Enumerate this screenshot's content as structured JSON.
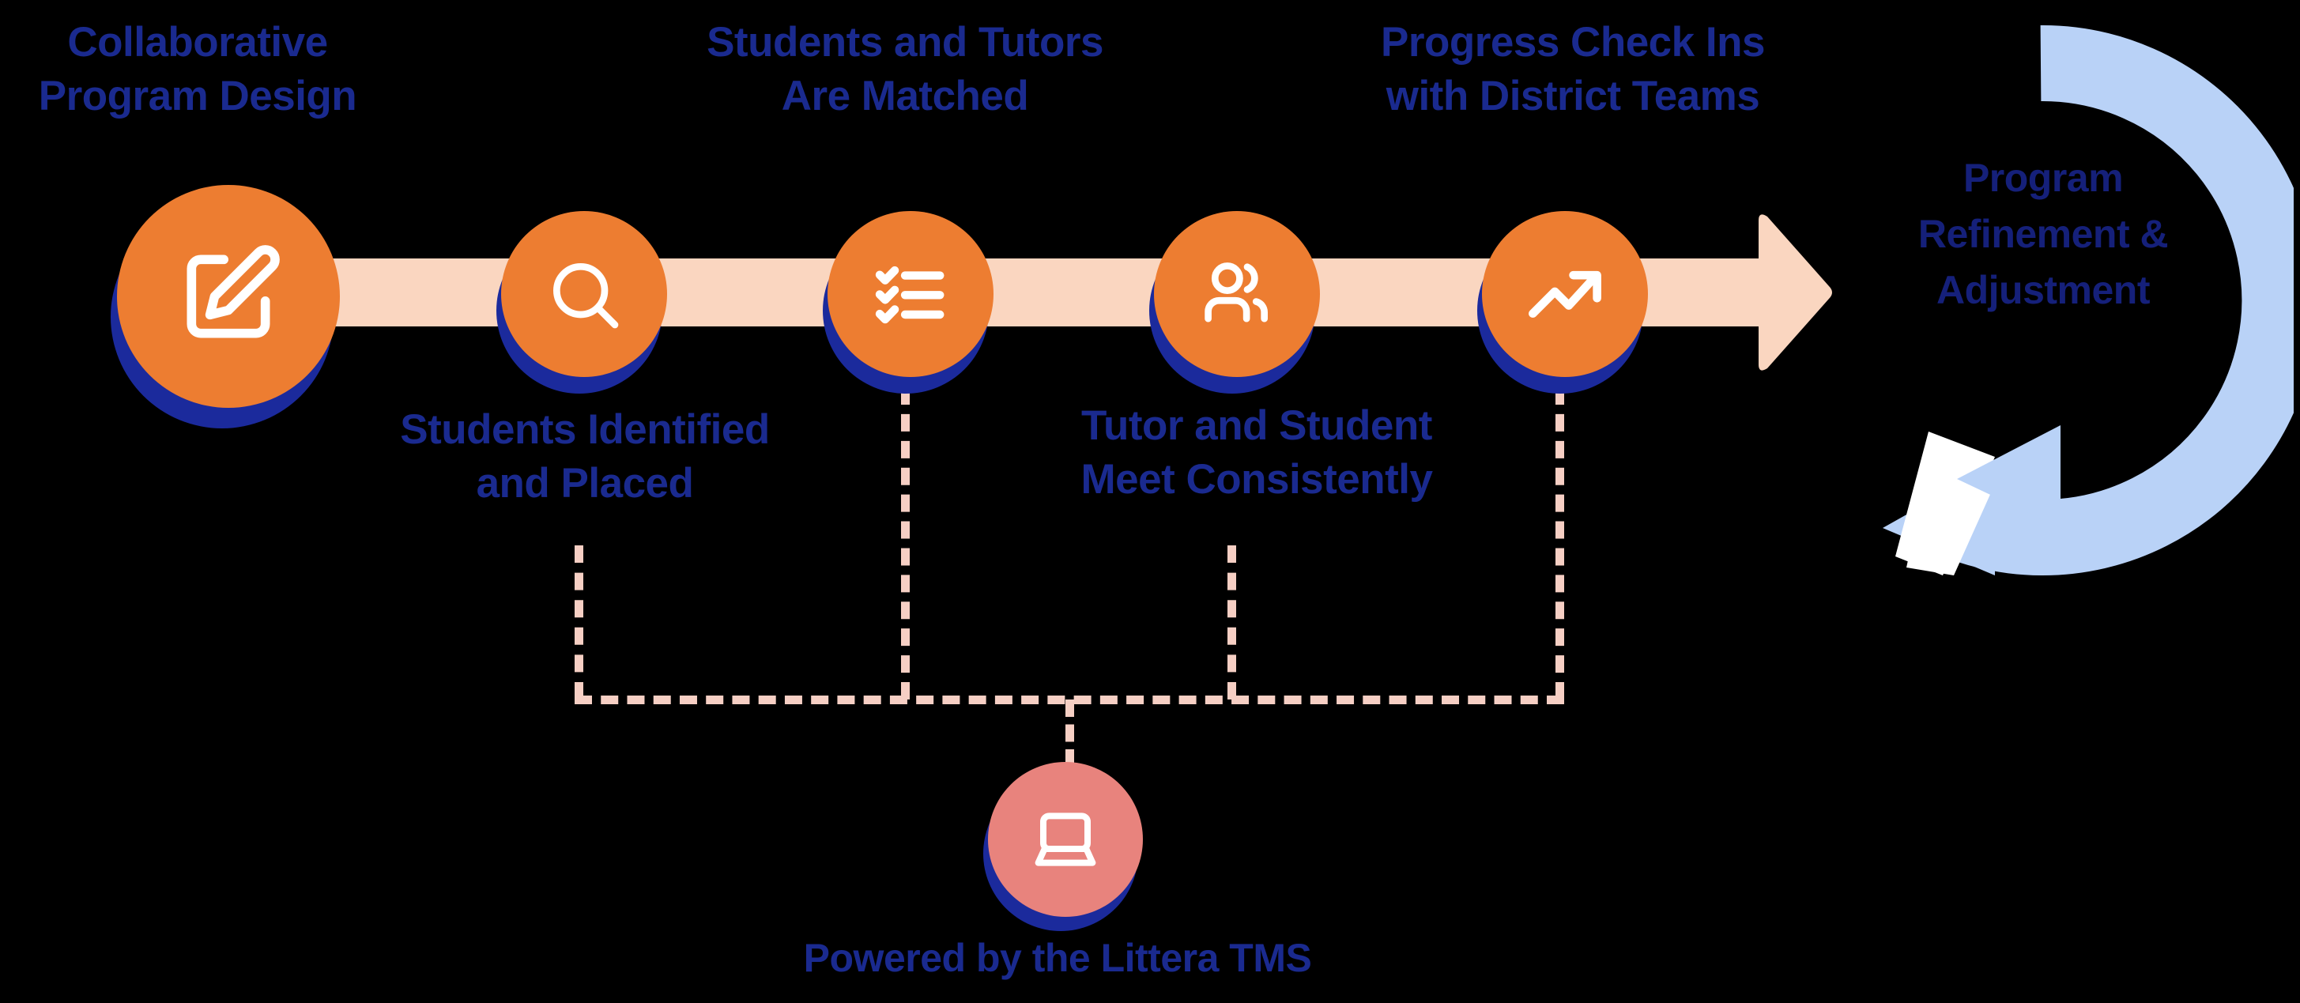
{
  "diagram": {
    "title_color": "#1a2a8f",
    "accent_orange": "#ed7d31",
    "shadow_blue": "#1b2a9c",
    "bar_peach": "#fad6c0",
    "dash_peach": "#f6cfc4",
    "ring_blue": "#b9d2f7",
    "tms_circle_color": "#e8837d"
  },
  "steps": [
    {
      "id": "step-1",
      "label": "Collaborative\nProgram Design",
      "label_position": "above",
      "icon": "edit-square-icon"
    },
    {
      "id": "step-2",
      "label": "Students Identified\nand Placed",
      "label_position": "below",
      "icon": "search-icon"
    },
    {
      "id": "step-3",
      "label": "Students and Tutors\nAre Matched",
      "label_position": "above",
      "icon": "checklist-icon"
    },
    {
      "id": "step-4",
      "label": "Tutor and Student\nMeet Consistently",
      "label_position": "below",
      "icon": "users-icon"
    },
    {
      "id": "step-5",
      "label": "Progress Check Ins\nwith District Teams",
      "label_position": "above",
      "icon": "trending-up-icon"
    }
  ],
  "cycle": {
    "label": "Program\nRefinement &\nAdjustment",
    "icon": "circular-arrow-icon"
  },
  "tms": {
    "label": "Powered by the Littera TMS",
    "icon": "laptop-icon"
  }
}
